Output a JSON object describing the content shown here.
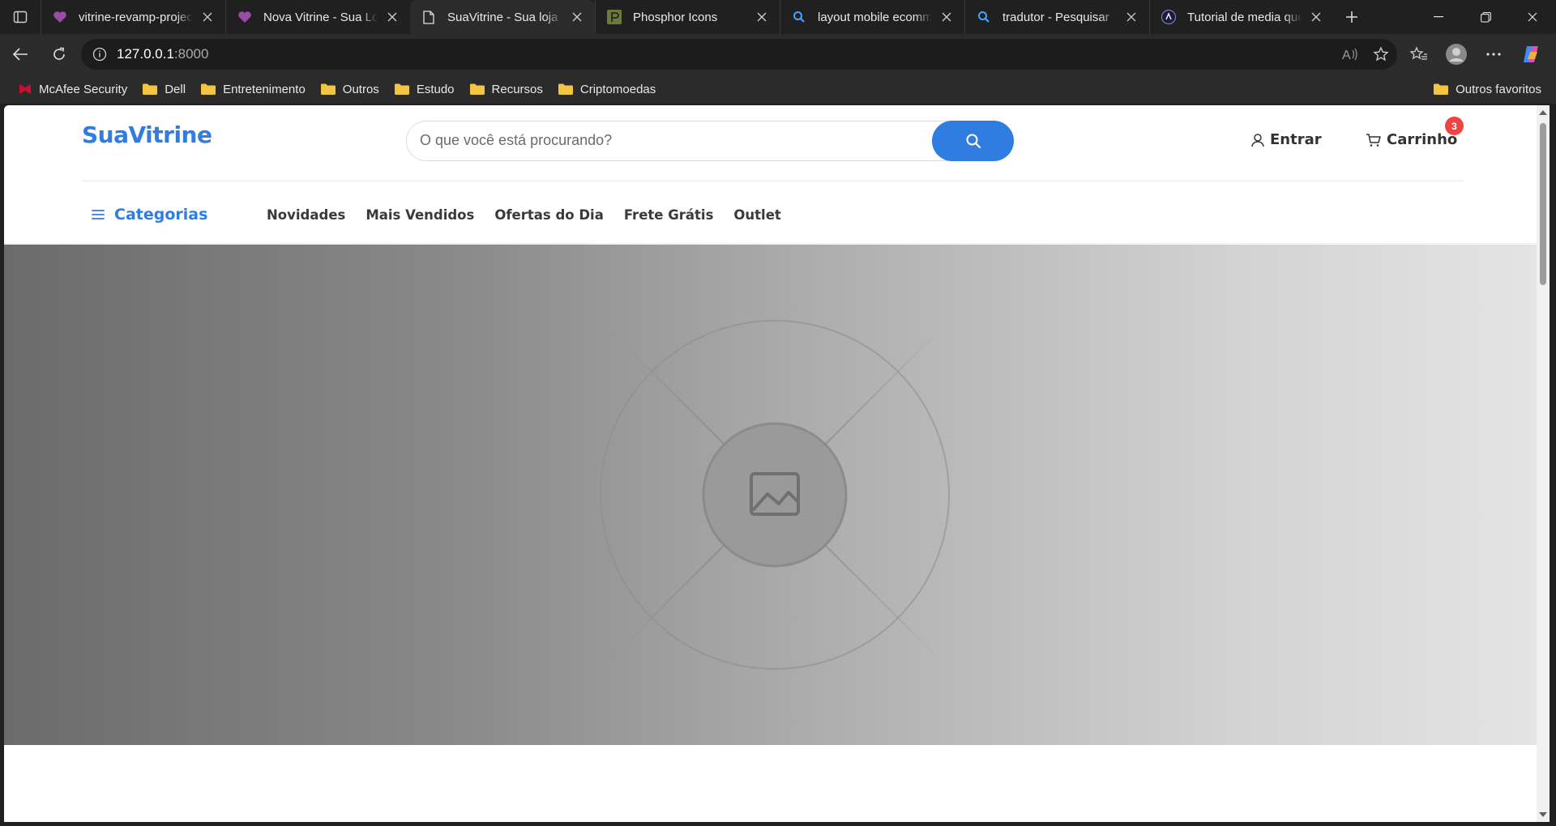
{
  "browser": {
    "tabs": [
      {
        "title": "vitrine-revamp-project",
        "active": false,
        "favicon": "heart-icon"
      },
      {
        "title": "Nova Vitrine - Sua Loja",
        "active": false,
        "favicon": "heart-icon"
      },
      {
        "title": "SuaVitrine - Sua loja on",
        "active": true,
        "favicon": "page-icon"
      },
      {
        "title": "Phosphor Icons",
        "active": false,
        "favicon": "phosphor-icon"
      },
      {
        "title": "layout mobile ecomme",
        "active": false,
        "favicon": "search-icon"
      },
      {
        "title": "tradutor - Pesquisar",
        "active": false,
        "favicon": "search-icon"
      },
      {
        "title": "Tutorial de media quer",
        "active": false,
        "favicon": "astro-icon"
      }
    ],
    "address": {
      "host": "127.0.0.1",
      "port": ":8000"
    },
    "bookmarks": [
      {
        "label": "McAfee Security",
        "icon": "mcafee-icon"
      },
      {
        "label": "Dell",
        "icon": "folder-icon"
      },
      {
        "label": "Entretenimento",
        "icon": "folder-icon"
      },
      {
        "label": "Outros",
        "icon": "folder-icon"
      },
      {
        "label": "Estudo",
        "icon": "folder-icon"
      },
      {
        "label": "Recursos",
        "icon": "folder-icon"
      },
      {
        "label": "Criptomoedas",
        "icon": "folder-icon"
      }
    ],
    "bookmarks_right": "Outros favoritos"
  },
  "site": {
    "logo": "SuaVitrine",
    "search": {
      "placeholder": "O que você está procurando?"
    },
    "login_label": "Entrar",
    "cart_label": "Carrinho",
    "cart_count": "3",
    "categories_label": "Categorias",
    "menu": [
      "Novidades",
      "Mais Vendidos",
      "Ofertas do Dia",
      "Frete Grátis",
      "Outlet"
    ]
  },
  "colors": {
    "brand": "#2f7de1",
    "badge": "#ef4444"
  }
}
